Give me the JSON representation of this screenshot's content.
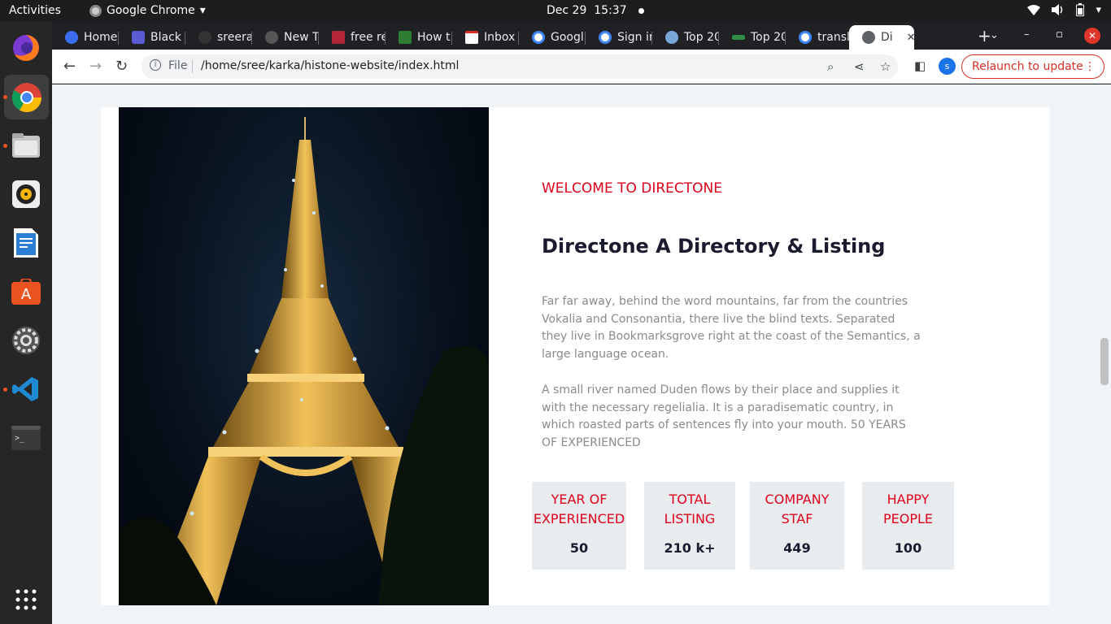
{
  "system_bar": {
    "activities": "Activities",
    "app_name": "Google Chrome",
    "date": "Dec 29",
    "time": "15:37"
  },
  "dock": {
    "items": [
      "firefox-icon",
      "chrome-icon",
      "files-icon",
      "rhythmbox-icon",
      "writer-icon",
      "software-icon",
      "settings-icon",
      "vscode-icon",
      "terminal-icon",
      "app-grid-icon"
    ]
  },
  "tabs": [
    {
      "label": "Home",
      "favicon_color": "#3b6df0"
    },
    {
      "label": "Black",
      "favicon_color": "#5b5bd6"
    },
    {
      "label": "sreera",
      "favicon_color": "#333333"
    },
    {
      "label": "New T",
      "favicon_color": "#555555"
    },
    {
      "label": "free re",
      "favicon_color": "#b3263a"
    },
    {
      "label": "How t",
      "favicon_color": "#2e7d32"
    },
    {
      "label": "Inbox",
      "favicon_color": "#d93025"
    },
    {
      "label": "Googl",
      "favicon_color": "#4285f4"
    },
    {
      "label": "Sign in",
      "favicon_color": "#4285f4"
    },
    {
      "label": "Top 20",
      "favicon_color": "#7aa7d9"
    },
    {
      "label": "Top 20",
      "favicon_color": "#2f8d46"
    },
    {
      "label": "transl",
      "favicon_color": "#4285f4"
    },
    {
      "label": "Di",
      "favicon_color": "#5f6368",
      "active": true
    }
  ],
  "toolbar": {
    "file_label": "File",
    "url": "/home/sree/karka/histone-website/index.html",
    "profile_initial": "s",
    "relaunch_label": "Relaunch to update"
  },
  "page": {
    "eyebrow": "WELCOME TO DIRECTONE",
    "heading": "Directone A Directory & Listing",
    "para1": "Far far away, behind the word mountains, far from the countries Vokalia and Consonantia, there live the blind texts. Separated they live in Bookmarksgrove right at the coast of the Semantics, a large language ocean.",
    "para2": "A small river named Duden flows by their place and supplies it with the necessary regelialia. It is a paradisematic country, in which roasted parts of sentences fly into your mouth. 50 YEARS OF EXPERIENCED",
    "stats": [
      {
        "line1": "YEAR OF",
        "line2": "EXPERIENCED",
        "value": "50"
      },
      {
        "line1": "TOTAL",
        "line2": "LISTING",
        "value": "210 k+"
      },
      {
        "line1": "COMPANY",
        "line2": "STAF",
        "value": "449"
      },
      {
        "line1": "HAPPY",
        "line2": "PEOPLE",
        "value": "100"
      }
    ],
    "accent_color": "#e0001a"
  }
}
